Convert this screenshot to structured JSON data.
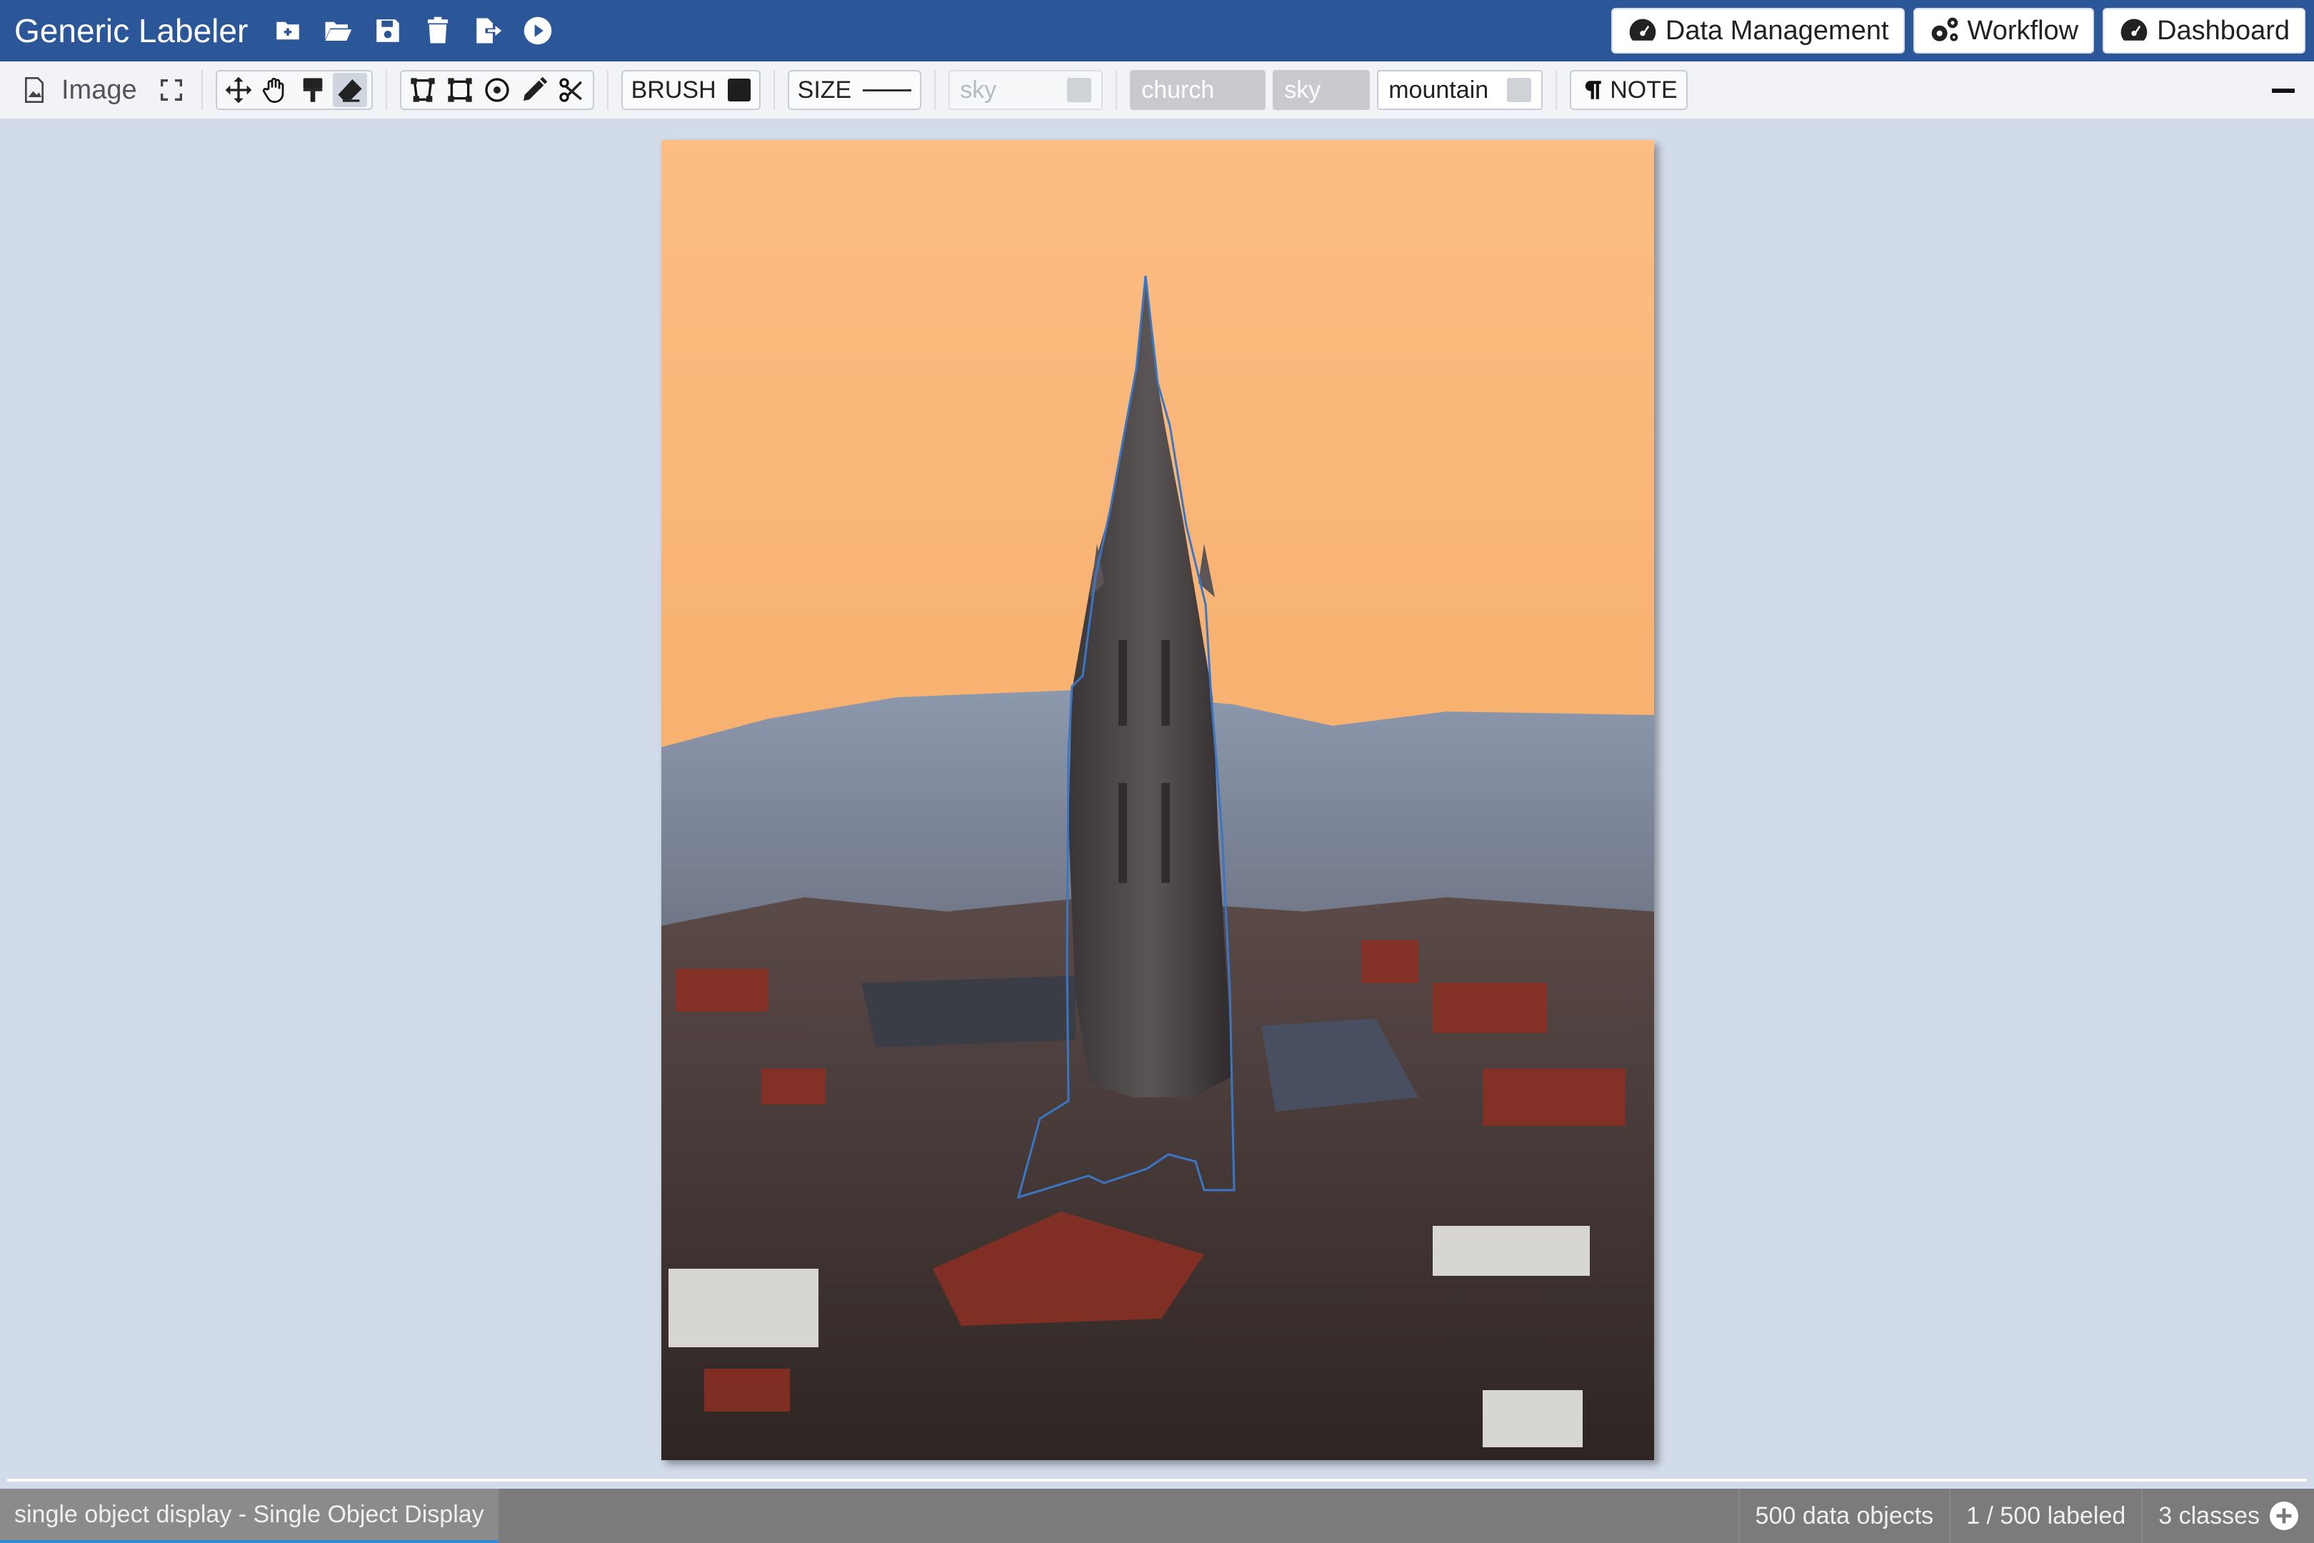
{
  "app": {
    "title": "Generic Labeler",
    "file_icons": [
      "new-file-icon",
      "open-folder-icon",
      "save-icon",
      "delete-icon",
      "export-icon",
      "run-icon"
    ],
    "nav_buttons": [
      {
        "label": "Data Management",
        "icon": "dashboard-icon"
      },
      {
        "label": "Workflow",
        "icon": "gears-icon"
      },
      {
        "label": "Dashboard",
        "icon": "dashboard-icon"
      }
    ],
    "colors": {
      "nav_bg": "#2b5799",
      "canvas_bg": "#d2dbe9",
      "status_bg": "#7b7b7b",
      "status_accent": "#2f8ad8",
      "outline": "#3a76c4"
    }
  },
  "toolbar": {
    "view_label": "Image",
    "brush_label": "BRUSH",
    "brush_color": "#1e1e1e",
    "size_label": "SIZE",
    "classes": [
      {
        "name": "sky",
        "state": "disabled"
      },
      {
        "name": "church",
        "state": "selected"
      },
      {
        "name": "sky",
        "state": "selected"
      },
      {
        "name": "mountain",
        "state": "default"
      }
    ],
    "note_label": "NOTE"
  },
  "status": {
    "view_tab": "single object display - Single Object Display",
    "data_objects": "500 data objects",
    "labeled": "1 / 500 labeled",
    "classes": "3 classes"
  }
}
